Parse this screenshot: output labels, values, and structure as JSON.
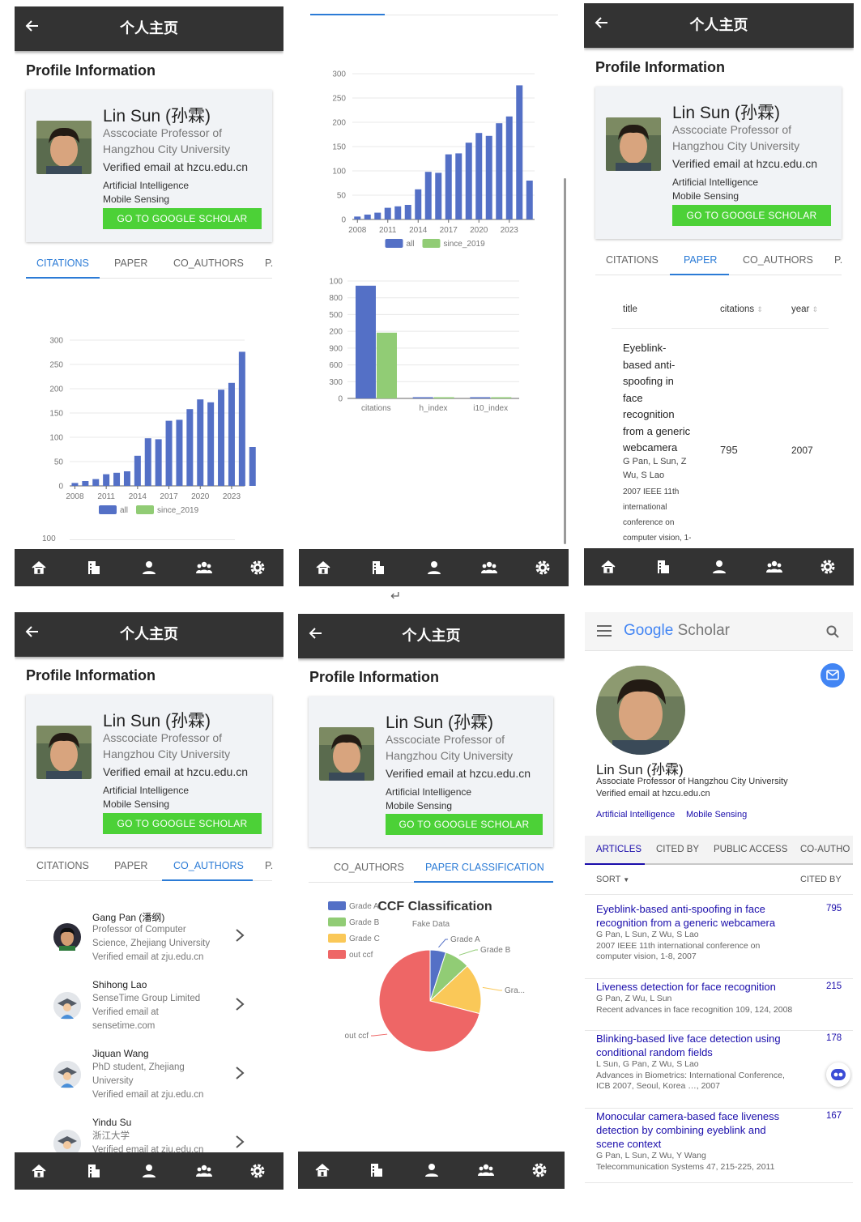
{
  "app": {
    "title": "个人主页",
    "section": "Profile Information",
    "nav_icons": [
      "home-icon",
      "building-icon",
      "person-icon",
      "group-icon",
      "settings-icon"
    ]
  },
  "profile": {
    "name": "Lin Sun (孙霖)",
    "aff1": "Asscociate Professor of",
    "aff2": "Hangzhou City University",
    "email": "Verified email at hzcu.edu.cn",
    "interest1": "Artificial Intelligence",
    "interest2": "Mobile Sensing",
    "button": "GO TO GOOGLE SCHOLAR"
  },
  "tabs": {
    "citations": "CITATIONS",
    "paper": "PAPER",
    "co_authors": "CO_AUTHORS",
    "p_cut": "P.",
    "paper_classification": "PAPER CLASSIFICATION"
  },
  "chart_data": [
    {
      "type": "bar",
      "x": [
        "2008",
        "2009",
        "2010",
        "2011",
        "2012",
        "2013",
        "2014",
        "2015",
        "2016",
        "2017",
        "2018",
        "2019",
        "2020",
        "2021",
        "2022",
        "2023",
        "2024"
      ],
      "xticks": [
        "2008",
        "2011",
        "2014",
        "2017",
        "2020",
        "2023"
      ],
      "series": [
        {
          "name": "all",
          "values": [
            6,
            10,
            14,
            24,
            27,
            30,
            62,
            98,
            96,
            134,
            136,
            158,
            178,
            172,
            198,
            212,
            276,
            80
          ]
        },
        {
          "name": "since_2019",
          "values": []
        }
      ],
      "ylim": [
        0,
        300
      ],
      "yticks": [
        "0",
        "50",
        "100",
        "150",
        "200",
        "250",
        "300"
      ],
      "legend": "bottom",
      "colors": {
        "all": "#5470c6",
        "since_2019": "#91cc75"
      }
    },
    {
      "type": "bar",
      "categories": [
        "citations",
        "h_index",
        "i10_index"
      ],
      "series": [
        {
          "name": "all",
          "values": [
            0.96,
            0.01,
            0.01
          ]
        },
        {
          "name": "since_2019",
          "values": [
            0.56,
            0.01,
            0.01
          ]
        }
      ],
      "yticks": [
        "0",
        "300",
        "600",
        "900",
        "200",
        "500",
        "800",
        "100"
      ]
    },
    {
      "type": "pie",
      "title": "CCF Classification",
      "subtitle": "Fake Data",
      "labels": [
        "Grade A",
        "Grade B",
        "Grade C",
        "out ccf"
      ],
      "label_short": [
        "Grade A",
        "Grade B",
        "Gra...",
        "out ccf"
      ],
      "values": [
        5,
        8,
        16,
        71
      ],
      "colors": [
        "#5470c6",
        "#91cc75",
        "#fac858",
        "#ee6666"
      ]
    }
  ],
  "chart_legend": {
    "all": "all",
    "since_2019": "since_2019",
    "axis_tail": "100"
  },
  "papers_table": {
    "headers": {
      "title": "title",
      "citations": "citations",
      "year": "year"
    },
    "title_lines": [
      "Eyeblink-",
      "based anti-",
      "spoofing in",
      "face",
      "recognition",
      "from a generic",
      "webcamera"
    ],
    "author_lines": [
      "G Pan, L Sun, Z",
      "Wu, S Lao"
    ],
    "venue_lines": [
      "2007 IEEE 11th",
      "international",
      "conference on",
      "computer vision, 1-"
    ],
    "citations": "795",
    "year": "2007"
  },
  "co_authors": [
    {
      "name": "Gang Pan (潘纲)",
      "lines": [
        "Professor of Computer",
        "Science, Zhejiang University",
        "Verified email at zju.edu.cn"
      ]
    },
    {
      "name": "Shihong Lao",
      "lines": [
        "SenseTime Group Limited",
        "Verified email at",
        "sensetime.com"
      ]
    },
    {
      "name": "Jiquan Wang",
      "lines": [
        "PhD student, Zhejiang",
        "University",
        "Verified email at zju.edu.cn"
      ]
    },
    {
      "name": "Yindu Su",
      "lines": [
        "浙江大学",
        "Verified email at zju.edu.cn"
      ]
    }
  ],
  "scholar": {
    "logo_google": "Google",
    "logo_scholar": "Scholar",
    "name": "Lin Sun (孙霖)",
    "aff": "Associate Professor of Hangzhou City University",
    "email": "Verified email at hzcu.edu.cn",
    "interest1": "Artificial Intelligence",
    "interest2": "Mobile Sensing",
    "tabs": [
      "ARTICLES",
      "CITED BY",
      "PUBLIC ACCESS",
      "CO-AUTHO"
    ],
    "sort": "SORT",
    "cited_by": "CITED BY",
    "articles": [
      {
        "t1": "Eyeblink-based anti-spoofing in face",
        "t2": "recognition from a generic webcamera",
        "t3": "",
        "m1": "G Pan, L Sun, Z Wu, S Lao",
        "m2": "2007 IEEE 11th international conference on",
        "m3": "computer vision, 1-8, 2007",
        "c": "795"
      },
      {
        "t1": "Liveness detection for face recognition",
        "t2": "",
        "t3": "",
        "m1": "G Pan, Z Wu, L Sun",
        "m2": "Recent advances in face recognition 109, 124, 2008",
        "m3": "",
        "c": "215"
      },
      {
        "t1": "Blinking-based live face detection using",
        "t2": "conditional random fields",
        "t3": "",
        "m1": "L Sun, G Pan, Z Wu, S Lao",
        "m2": "Advances in Biometrics: International Conference,",
        "m3": "ICB 2007, Seoul, Korea …, 2007",
        "c": "178"
      },
      {
        "t1": "Monocular camera-based face liveness",
        "t2": "detection by combining eyeblink and",
        "t3": "scene context",
        "m1": "G Pan, L Sun, Z Wu, Y Wang",
        "m2": "Telecommunication Systems 47, 215-225, 2011",
        "m3": "",
        "c": "167"
      }
    ]
  },
  "misc": {
    "return_glyph": "↵"
  }
}
